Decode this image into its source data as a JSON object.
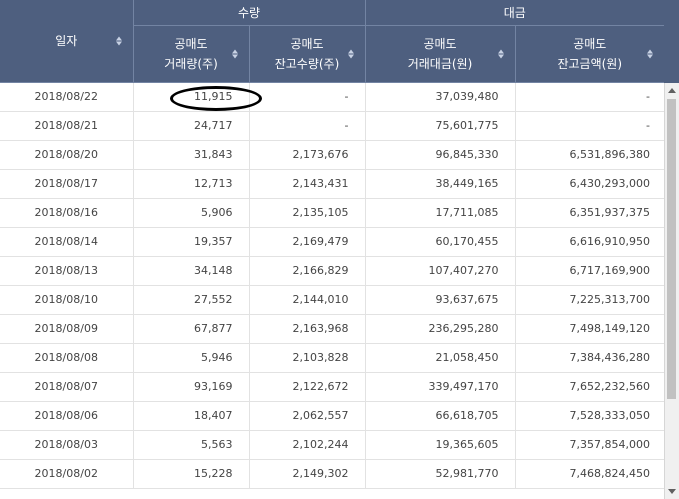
{
  "headers": {
    "date": "일자",
    "qty_group": "수량",
    "amt_group": "대금",
    "cols": [
      {
        "line1": "공매도",
        "line2": "거래량(주)"
      },
      {
        "line1": "공매도",
        "line2": "잔고수량(주)"
      },
      {
        "line1": "공매도",
        "line2": "거래대금(원)"
      },
      {
        "line1": "공매도",
        "line2": "잔고금액(원)"
      }
    ]
  },
  "rows": [
    {
      "date": "2018/08/22",
      "volume": "11,915",
      "balance_qty": "-",
      "trade_amt": "37,039,480",
      "balance_amt": "-"
    },
    {
      "date": "2018/08/21",
      "volume": "24,717",
      "balance_qty": "-",
      "trade_amt": "75,601,775",
      "balance_amt": "-"
    },
    {
      "date": "2018/08/20",
      "volume": "31,843",
      "balance_qty": "2,173,676",
      "trade_amt": "96,845,330",
      "balance_amt": "6,531,896,380"
    },
    {
      "date": "2018/08/17",
      "volume": "12,713",
      "balance_qty": "2,143,431",
      "trade_amt": "38,449,165",
      "balance_amt": "6,430,293,000"
    },
    {
      "date": "2018/08/16",
      "volume": "5,906",
      "balance_qty": "2,135,105",
      "trade_amt": "17,711,085",
      "balance_amt": "6,351,937,375"
    },
    {
      "date": "2018/08/14",
      "volume": "19,357",
      "balance_qty": "2,169,479",
      "trade_amt": "60,170,455",
      "balance_amt": "6,616,910,950"
    },
    {
      "date": "2018/08/13",
      "volume": "34,148",
      "balance_qty": "2,166,829",
      "trade_amt": "107,407,270",
      "balance_amt": "6,717,169,900"
    },
    {
      "date": "2018/08/10",
      "volume": "27,552",
      "balance_qty": "2,144,010",
      "trade_amt": "93,637,675",
      "balance_amt": "7,225,313,700"
    },
    {
      "date": "2018/08/09",
      "volume": "67,877",
      "balance_qty": "2,163,968",
      "trade_amt": "236,295,280",
      "balance_amt": "7,498,149,120"
    },
    {
      "date": "2018/08/08",
      "volume": "5,946",
      "balance_qty": "2,103,828",
      "trade_amt": "21,058,450",
      "balance_amt": "7,384,436,280"
    },
    {
      "date": "2018/08/07",
      "volume": "93,169",
      "balance_qty": "2,122,672",
      "trade_amt": "339,497,170",
      "balance_amt": "7,652,232,560"
    },
    {
      "date": "2018/08/06",
      "volume": "18,407",
      "balance_qty": "2,062,557",
      "trade_amt": "66,618,705",
      "balance_amt": "7,528,333,050"
    },
    {
      "date": "2018/08/03",
      "volume": "5,563",
      "balance_qty": "2,102,244",
      "trade_amt": "19,365,605",
      "balance_amt": "7,357,854,000"
    },
    {
      "date": "2018/08/02",
      "volume": "15,228",
      "balance_qty": "2,149,302",
      "trade_amt": "52,981,770",
      "balance_amt": "7,468,824,450"
    }
  ],
  "colors": {
    "header_bg": "#4e5f7f",
    "annotation": "#000000"
  }
}
